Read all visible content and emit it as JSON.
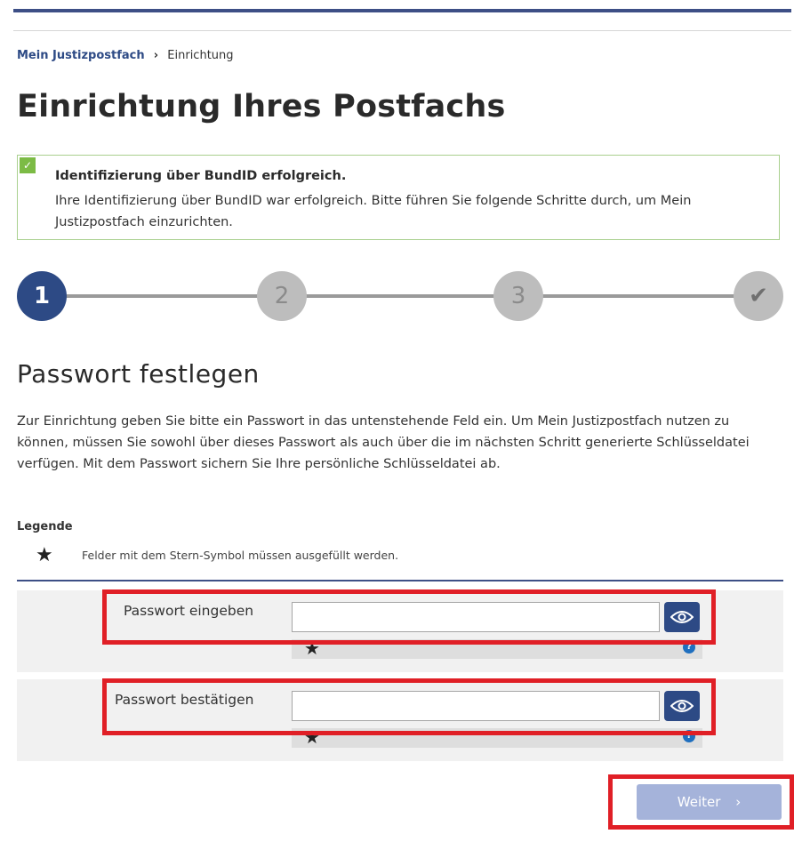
{
  "breadcrumb": {
    "home": "Mein Justizpostfach",
    "separator": "›",
    "current": "Einrichtung"
  },
  "page_title": "Einrichtung Ihres Postfachs",
  "alert": {
    "title": "Identifizierung über BundID erfolgreich.",
    "text": "Ihre Identifizierung über BundID war erfolgreich. Bitte führen Sie folgende Schritte durch, um Mein Justizpostfach einzurichten.",
    "check_icon": "✓"
  },
  "stepper": {
    "steps": [
      {
        "label": "1",
        "state": "active"
      },
      {
        "label": "2",
        "state": "inactive"
      },
      {
        "label": "3",
        "state": "inactive"
      },
      {
        "label": "✔",
        "state": "inactive"
      }
    ]
  },
  "section_title": "Passwort festlegen",
  "intro": "Zur Einrichtung geben Sie bitte ein Passwort in das untenstehende Feld ein. Um Mein Justizpostfach nutzen zu können, müssen Sie sowohl über dieses Passwort als auch über die im nächsten Schritt generierte Schlüsseldatei verfügen. Mit dem Passwort sichern Sie Ihre persönliche Schlüsseldatei ab.",
  "legend": {
    "title": "Legende",
    "star": "★",
    "text": "Felder mit dem Stern-Symbol müssen ausgefüllt werden."
  },
  "fields": {
    "password": {
      "label": "Passwort eingeben",
      "value": "",
      "placeholder": ""
    },
    "confirm": {
      "label": "Passwort bestätigen",
      "value": "",
      "placeholder": ""
    },
    "required_star": "★",
    "help_icon": "?"
  },
  "next_button": {
    "label": "Weiter",
    "chevron": "›"
  },
  "colors": {
    "primary": "#2d4a85",
    "success": "#7cbb45",
    "highlight": "#e01f26",
    "button_disabled": "#a5b3da"
  }
}
